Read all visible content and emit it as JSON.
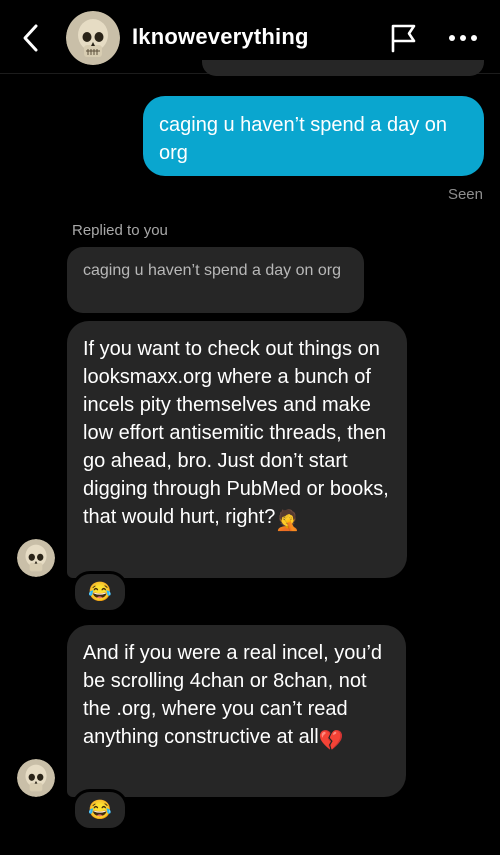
{
  "header": {
    "username": "Iknoweverything"
  },
  "messages": {
    "outgoing_text": "caging u haven’t spend a day on org",
    "seen_label": "Seen",
    "replied_label": "Replied to you",
    "quoted_text": "caging u haven’t spend a day on org",
    "incoming_1_text": "If you want to check out things on looksmaxx.org where a bunch of incels pity themselves and make low effort antisemitic threads, then go ahead, bro. Just don’t start digging through PubMed or books, that would hurt, right?",
    "incoming_1_emoji": "🤦",
    "incoming_1_reaction": "😂",
    "incoming_2_text": "And if you were a real incel, you’d be scrolling 4chan or 8chan, not the .org, where you can’t read anything constructive at all",
    "incoming_2_emoji": "💔",
    "incoming_2_reaction": "😂"
  },
  "colors": {
    "outgoing_bubble": "#0aa6cf",
    "incoming_bubble": "#262626",
    "background": "#000000"
  }
}
